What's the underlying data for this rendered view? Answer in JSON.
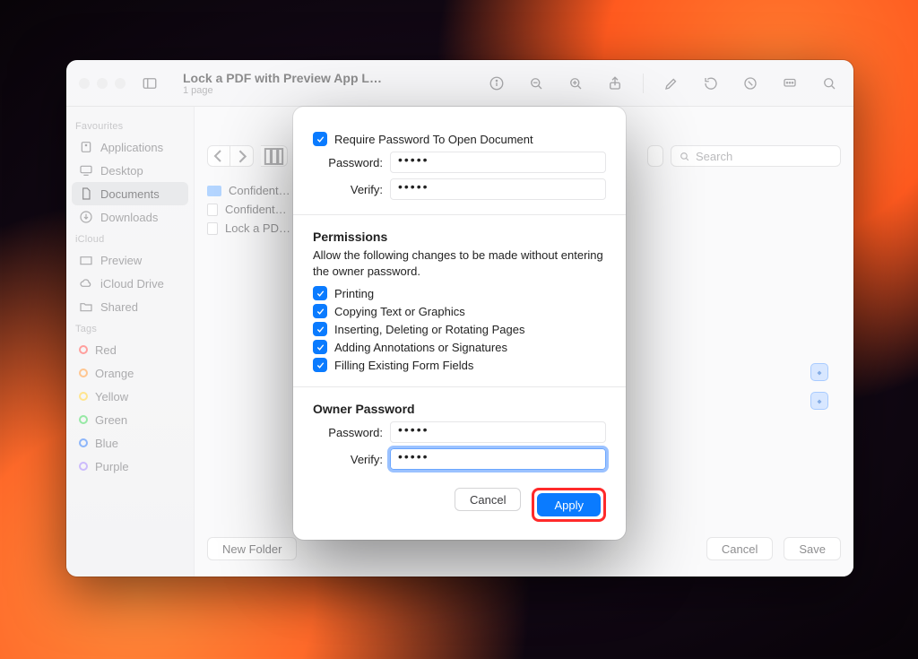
{
  "window": {
    "title": "Lock a PDF with Preview App L…",
    "subtitle": "1 page"
  },
  "sidebar": {
    "sections": [
      {
        "header": "Favourites",
        "items": [
          {
            "label": "Applications"
          },
          {
            "label": "Desktop"
          },
          {
            "label": "Documents"
          },
          {
            "label": "Downloads"
          }
        ],
        "active_index": 2
      },
      {
        "header": "iCloud",
        "items": [
          {
            "label": "Preview"
          },
          {
            "label": "iCloud Drive"
          },
          {
            "label": "Shared"
          }
        ]
      },
      {
        "header": "Tags",
        "items": [
          {
            "label": "Red",
            "color": "#ff5b56"
          },
          {
            "label": "Orange",
            "color": "#ff9e42"
          },
          {
            "label": "Yellow",
            "color": "#ffd23f"
          },
          {
            "label": "Green",
            "color": "#4cd964"
          },
          {
            "label": "Blue",
            "color": "#3b82f6"
          },
          {
            "label": "Purple",
            "color": "#a78bfa"
          }
        ]
      }
    ]
  },
  "content": {
    "search_placeholder": "Search",
    "files": [
      {
        "label": "Confident…"
      },
      {
        "label": "Confident…"
      },
      {
        "label": "Lock a PD…"
      }
    ]
  },
  "save_footer": {
    "new_folder": "New Folder",
    "cancel": "Cancel",
    "save": "Save"
  },
  "dialog": {
    "require_label": "Require Password To Open Document",
    "password_label": "Password:",
    "verify_label": "Verify:",
    "password_value": "•••••",
    "verify_value": "•••••",
    "permissions_header": "Permissions",
    "permissions_sub": "Allow the following changes to be made without entering the owner password.",
    "permissions": [
      "Printing",
      "Copying Text or Graphics",
      "Inserting, Deleting or Rotating Pages",
      "Adding Annotations or Signatures",
      "Filling Existing Form Fields"
    ],
    "owner_header": "Owner Password",
    "owner_password_value": "•••••",
    "owner_verify_value": "•••••",
    "cancel": "Cancel",
    "apply": "Apply"
  }
}
